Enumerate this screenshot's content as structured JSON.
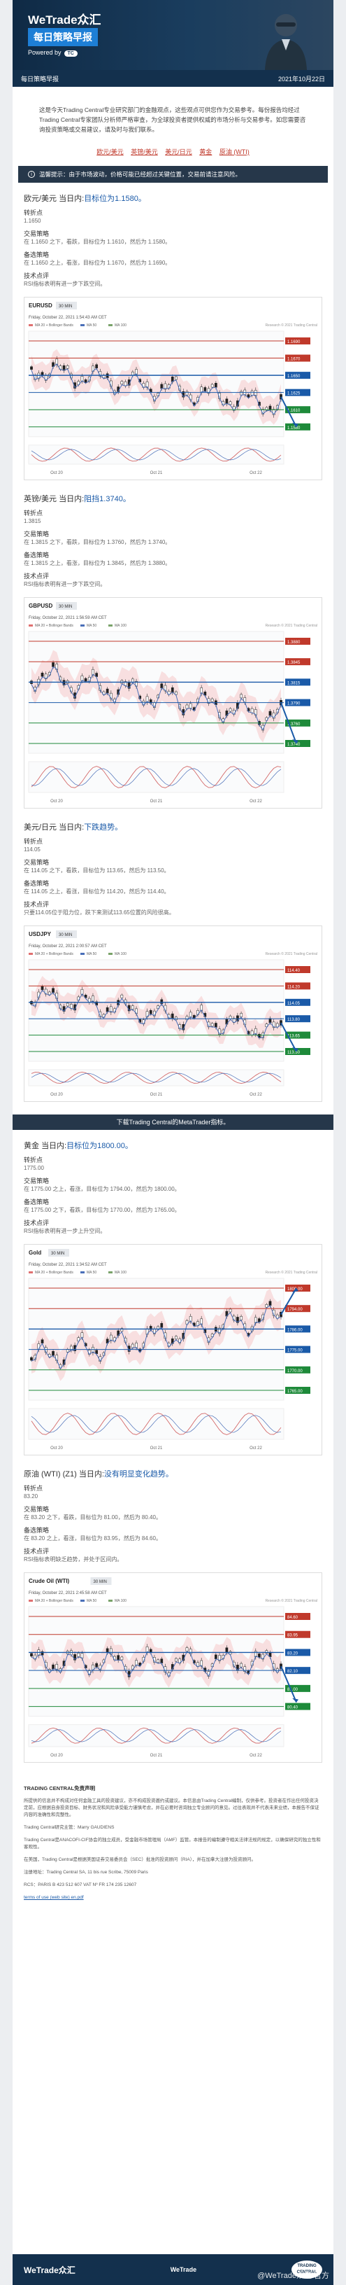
{
  "banner": {
    "logo": "WeTrade众汇",
    "title": "每日策略早报",
    "powered": "Powered by",
    "tc_badge": "TC"
  },
  "datebar": {
    "left": "每日策略早报",
    "right": "2021年10月22日"
  },
  "intro": "这是今天Trading Central专业研究部门的金融观点，这些观点可供您作为交易参考。每份报告均经过Trading Central专家团队分析师严格审查，为全球投资者提供权威的市场分析与交易参考。如您需要咨询投资策略或交易建议，请及时与我们联系。",
  "links": [
    "欧元/美元",
    "英镑/美元",
    "美元/日元",
    "黄金",
    "原油 (WTI)"
  ],
  "notice": "温馨提示：由于市场波动，价格可能已经超过关键位置，交易前请注意风险。",
  "sections": [
    {
      "pair": "欧元/美元",
      "status": "当日内:",
      "view": "目标位为1.1580。",
      "pivot_label": "转折点",
      "pivot": "1.1650",
      "strat_label": "交易策略",
      "strat": "在 1.1650 之下，看跌，目标位为 1.1610，然后为 1.1580。",
      "alt_label": "备选策略",
      "alt": "在 1.1650 之上，看涨，目标位为 1.1670，然后为 1.1690。",
      "tech_label": "技术点评",
      "tech": "RSI指标表明有进一步下跌空间。",
      "chart": {
        "symbol": "EURUSD",
        "tf": "30 MIN",
        "time": "Friday, October 22, 2021 1:54:43 AM CET",
        "legend": [
          "MA 20 + Bollinger Bands",
          "MA 50",
          "MA 100"
        ],
        "copyright": "Research © 2021 Trading Central",
        "x_ticks": [
          "Oct 20",
          "Oct 21",
          "Oct 22"
        ],
        "levels": [
          "1.1690",
          "1.1670",
          "1.1650",
          "1.1625",
          "1.1610",
          "1.1580"
        ]
      }
    },
    {
      "pair": "英镑/美元",
      "status": "当日内:",
      "view": "阻挡1.3740。",
      "pivot_label": "转折点",
      "pivot": "1.3815",
      "strat_label": "交易策略",
      "strat": "在 1.3815 之下，看跌，目标位为 1.3760，然后为 1.3740。",
      "alt_label": "备选策略",
      "alt": "在 1.3815 之上，看涨，目标位为 1.3845，然后为 1.3880。",
      "tech_label": "技术点评",
      "tech": "RSI指标表明有进一步下跌空间。",
      "chart": {
        "symbol": "GBPUSD",
        "tf": "30 MIN",
        "time": "Friday, October 22, 2021 1:56:59 AM CET",
        "legend": [
          "MA 20 + Bollinger Bands",
          "MA 50",
          "MA 100"
        ],
        "copyright": "Research © 2021 Trading Central",
        "x_ticks": [
          "Oct 20",
          "Oct 21",
          "Oct 22"
        ],
        "levels": [
          "1.3880",
          "1.3845",
          "1.3815",
          "1.3790",
          "1.3760",
          "1.3740"
        ]
      }
    },
    {
      "pair": "美元/日元",
      "status": "当日内:",
      "view": "下跌趋势。",
      "pivot_label": "转折点",
      "pivot": "114.05",
      "strat_label": "交易策略",
      "strat": "在 114.05 之下，看跌，目标位为 113.65，然后为 113.50。",
      "alt_label": "备选策略",
      "alt": "在 114.05 之上，看涨，目标位为 114.20，然后为 114.40。",
      "tech_label": "技术点评",
      "tech": "只要114.05位于阻力位，跌下来测试113.65位置的风险很高。",
      "chart": {
        "symbol": "USDJPY",
        "tf": "30 MIN",
        "time": "Friday, October 22, 2021 2:00:57 AM CET",
        "legend": [
          "MA 20 + Bollinger Bands",
          "MA 50",
          "MA 100"
        ],
        "copyright": "Research © 2021 Trading Central",
        "x_ticks": [
          "Oct 20",
          "Oct 21",
          "Oct 22"
        ],
        "levels": [
          "114.40",
          "114.20",
          "114.05",
          "113.80",
          "113.65",
          "113.50"
        ]
      }
    },
    {
      "pair": "黄金",
      "status": "当日内:",
      "view": "目标位为1800.00。",
      "pivot_label": "转折点",
      "pivot": "1775.00",
      "strat_label": "交易策略",
      "strat": "在 1775.00 之上，看涨，目标位为 1794.00，然后为 1800.00。",
      "alt_label": "备选策略",
      "alt": "在 1775.00 之下，看跌，目标位为 1770.00，然后为 1765.00。",
      "tech_label": "技术点评",
      "tech": "RSI指标表明有进一步上升空间。",
      "chart": {
        "symbol": "Gold",
        "tf": "30 MIN",
        "time": "Friday, October 22, 2021 1:34:52 AM CET",
        "legend": [
          "MA 20 + Bollinger Bands",
          "MA 50",
          "MA 100"
        ],
        "copyright": "Research © 2021 Trading Central",
        "x_ticks": [
          "Oct 20",
          "Oct 21",
          "Oct 22"
        ],
        "levels": [
          "1800.00",
          "1794.00",
          "1786.00",
          "1775.00",
          "1770.00",
          "1765.00"
        ]
      }
    },
    {
      "pair": "原油 (WTI) (Z1)",
      "status": "当日内:",
      "view": "没有明显变化趋势。",
      "pivot_label": "转折点",
      "pivot": "83.20",
      "strat_label": "交易策略",
      "strat": "在 83.20 之下，看跌，目标位为 81.00，然后为 80.40。",
      "alt_label": "备选策略",
      "alt": "在 83.20 之上，看涨，目标位为 83.95，然后为 84.60。",
      "tech_label": "技术点评",
      "tech": "RSI指标表明缺乏趋势，并处于区间内。",
      "chart": {
        "symbol": "Crude Oil (WTI)",
        "tf": "30 MIN",
        "time": "Friday, October 22, 2021 2:45:58 AM CET",
        "legend": [
          "MA 20 + Bollinger Bands",
          "MA 50",
          "MA 100"
        ],
        "copyright": "Research © 2021 Trading Central",
        "x_ticks": [
          "Oct 20",
          "Oct 21",
          "Oct 22"
        ],
        "levels": [
          "84.60",
          "83.95",
          "83.20",
          "82.10",
          "81.00",
          "80.40"
        ]
      }
    }
  ],
  "download": "下载Trading Central的MetaTrader指标。",
  "disclaimer": {
    "title": "TRADING CENTRAL免责声明",
    "p1": "所提供的信息并不构成对任何金融工具的投资建议，亦不构成投资邀约或建议。本信息由Trading Central编制，仅供参考。投资者在作出任何投资决定前，应根据自身投资目标、财务状况和风险承受能力谨慎考虑，并在必要时咨询独立专业顾问的意见。过往表现并不代表未来业绩，本报告不保证内容的准确性和完整性。",
    "p2": "Trading Central研究主管：Marry GAUDIENS",
    "p3": "Trading Central是ANACOFI-CIF协会的独立成员，受金融市场管理局（AMF）监管。本报告的编制遵守相关法律法规的规定，以确保研究的独立性和客观性。",
    "p4": "在美国，Trading Central是根据美国证券交易委员会（SEC）批准的投资顾问（RIA），并在加拿大注册为投资顾问。",
    "p5": "注册地址：Trading Central SA, 11 bis rue Scribe, 75009 Paris",
    "p6": "RCS：PARIS B 423 512 607 VAT Nº FR 174 235 12607",
    "terms": "terms of use (web site) en.pdf"
  },
  "footer": {
    "logo": "WeTrade众汇",
    "center": "WeTrade",
    "badge": "TRADING CENTRAL",
    "watermark": "@WeTrade众汇 官方"
  }
}
